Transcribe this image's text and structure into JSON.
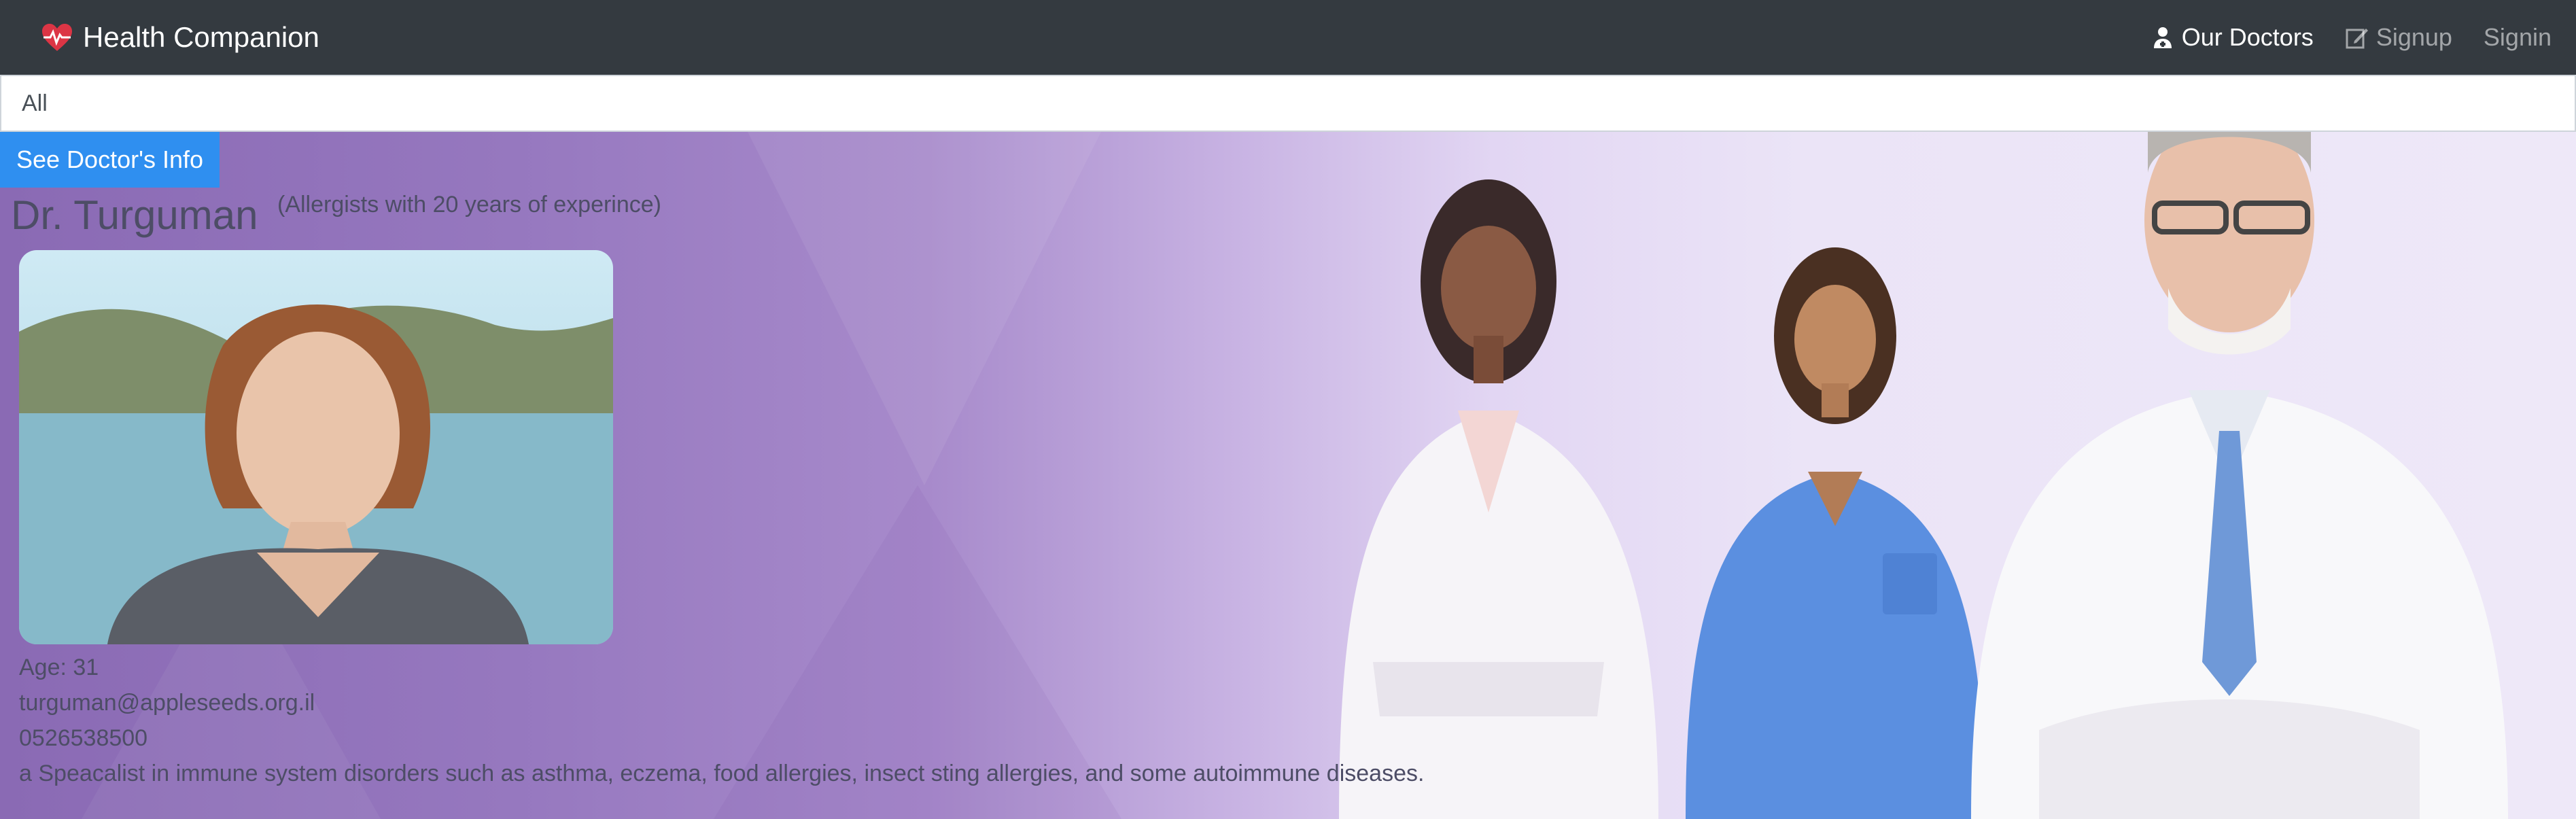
{
  "navbar": {
    "brand": "Health Companion",
    "links": [
      {
        "label": "Our Doctors",
        "icon": "user-doctor-icon"
      },
      {
        "label": "Signup",
        "icon": "edit-icon"
      },
      {
        "label": "Signin"
      }
    ]
  },
  "filter": {
    "selected": "All"
  },
  "doctor": {
    "button_label": "See Doctor's Info",
    "name": "Dr. Turguman",
    "specialty": "(Allergists with 20 years of experince)",
    "age": "Age: 31",
    "email": "turguman@appleseeds.org.il",
    "phone": "0526538500",
    "description": "a Speacalist in immune system disorders such as asthma, eczema, food allergies, insect sting allergies, and some autoimmune diseases."
  },
  "colors": {
    "navbar": "#343a40",
    "button": "#2f8ff0",
    "heart": "#dc3545"
  }
}
